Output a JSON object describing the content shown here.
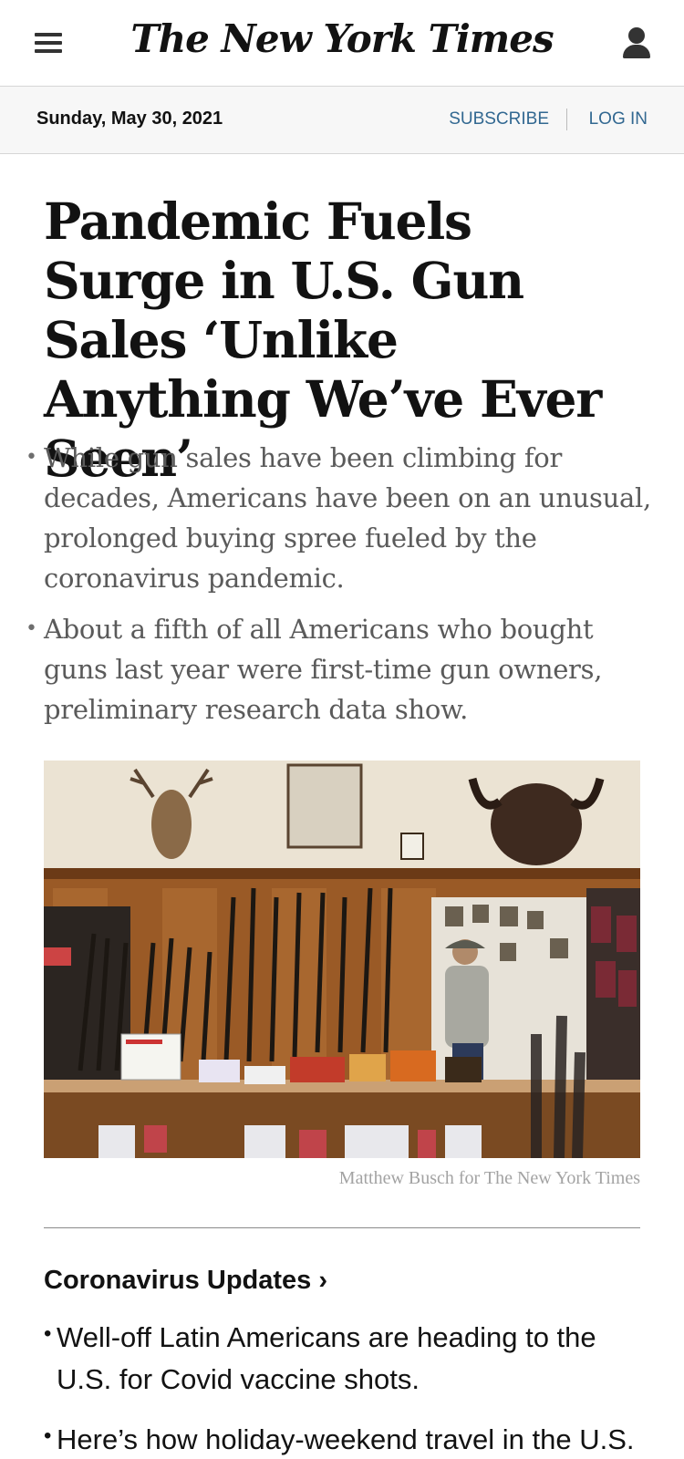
{
  "header": {
    "masthead": "The New York Times",
    "menu_icon": "hamburger-menu-icon",
    "account_icon": "user-account-icon"
  },
  "datebar": {
    "date": "Sunday, May 30, 2021",
    "subscribe": "SUBSCRIBE",
    "separator": "|",
    "login": "LOG IN"
  },
  "article": {
    "headline": "Pandemic Fuels Surge in U.S. Gun Sales ‘Unlike Anything We’ve Ever Seen’",
    "summary": [
      "While gun sales have been climbing for decades, Americans have been on an unusual, prolonged buying spree fueled by the coronavirus pandemic.",
      "About a fifth of all Americans who bought guns last year were first-time gun owners, preliminary research data show."
    ],
    "photo_credit": "Matthew Busch for The New York Times"
  },
  "updates": {
    "heading": "Coronavirus Updates ›",
    "items": [
      "Well-off Latin Americans are heading to the U.S. for Covid vaccine shots.",
      "Here’s how holiday-weekend travel in the U.S."
    ]
  },
  "colors": {
    "link_blue": "#326891",
    "text": "#121212",
    "summary_gray": "#5a5a5a",
    "datebar_bg": "#f7f7f7"
  }
}
